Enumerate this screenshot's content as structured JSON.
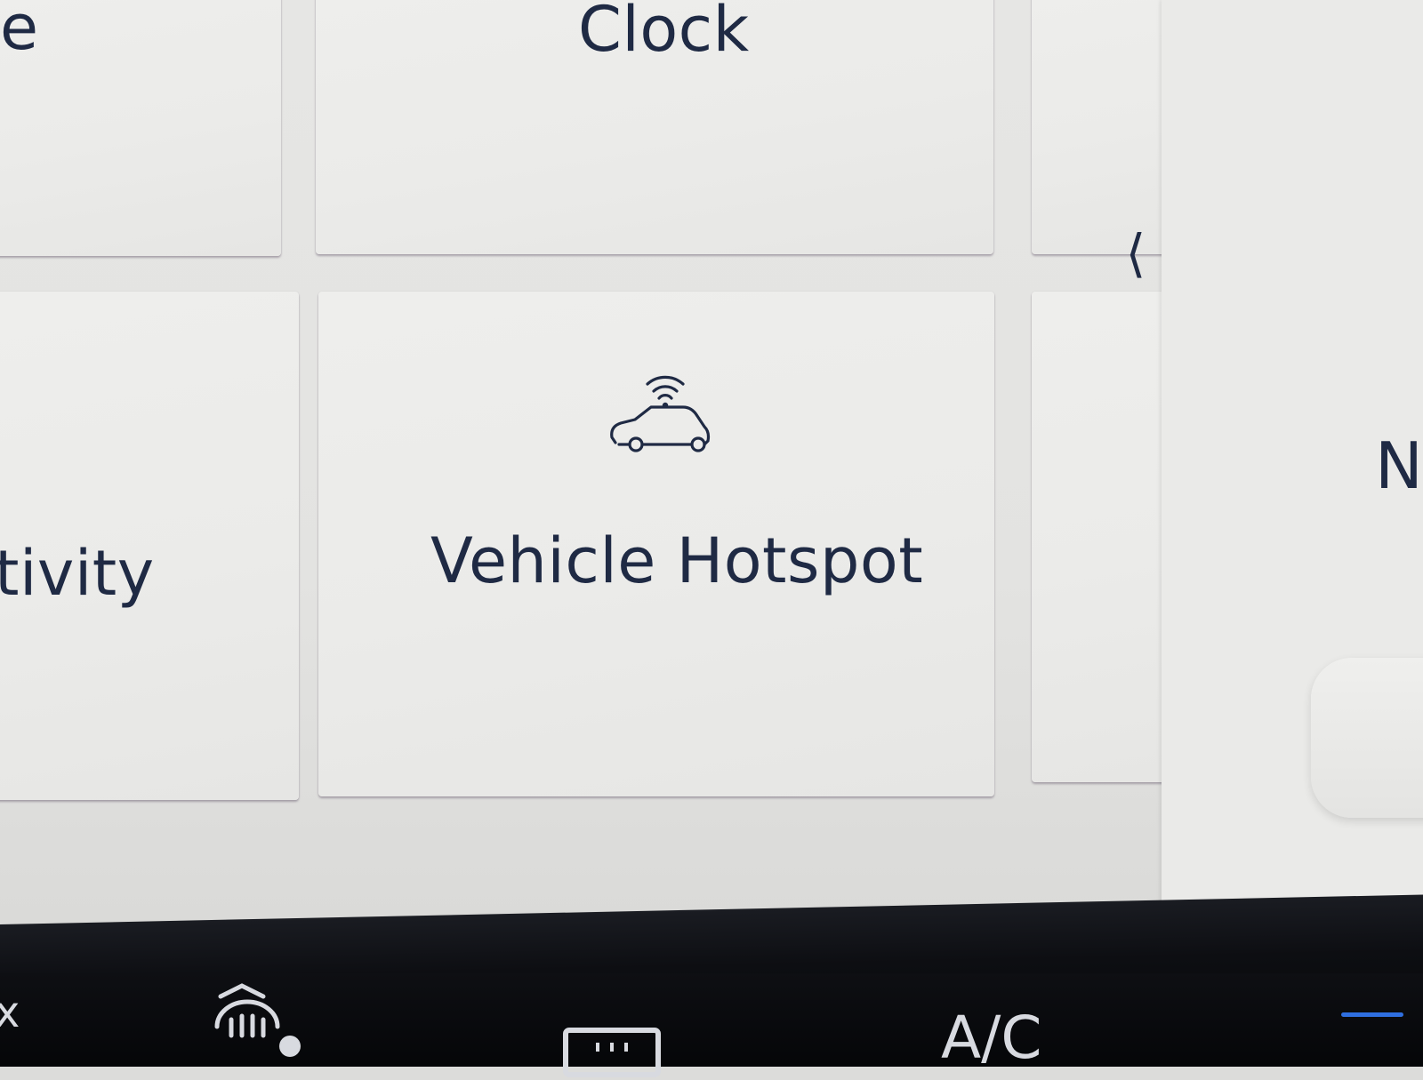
{
  "tiles": {
    "top_left_partial": {
      "label": "le"
    },
    "clock": {
      "label": "Clock"
    },
    "connectivity_partial": {
      "label": "tivity"
    },
    "vehicle_hotspot": {
      "label": "Vehicle Hotspot",
      "icon": "car-wifi-icon"
    }
  },
  "side_panel": {
    "partial_text": "No"
  },
  "back_control": {
    "icon": "chevron-left-icon"
  },
  "climate_bar": {
    "partial_left": "x",
    "ac_label": "A/C",
    "icons": [
      "defrost-rear-icon",
      "rear-window-icon",
      "slider-indicator-icon"
    ],
    "accent_color": "#2f6fe0"
  },
  "colors": {
    "text": "#1f2a44",
    "tile_bg": "#ececea",
    "screen_bg": "#e4e4e2",
    "bar_bg": "#0a0b0e"
  }
}
